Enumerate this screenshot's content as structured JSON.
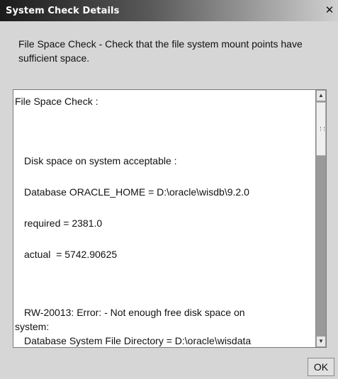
{
  "window": {
    "title": "System Check Details",
    "close_glyph": "✕"
  },
  "description": "File Space Check - Check that the file system mount points have sufficient space.",
  "details": {
    "lines": [
      "File Space Check :",
      "Disk space on system acceptable :",
      "Database ORACLE_HOME = D:\\oracle\\wisdb\\9.2.0",
      "required = 2381.0",
      "actual  = 5742.90625",
      "RW-20013: Error: - Not enough free disk space on",
      "system:",
      "Database System File Directory = D:\\oracle\\wisdata"
    ]
  },
  "scrollbar": {
    "up_glyph": "▲",
    "down_glyph": "▼"
  },
  "buttons": {
    "ok_label": "OK"
  },
  "colors": {
    "title_start": "#1b1b1b",
    "title_end": "#d0d0d0",
    "background": "#d6d6d6"
  }
}
